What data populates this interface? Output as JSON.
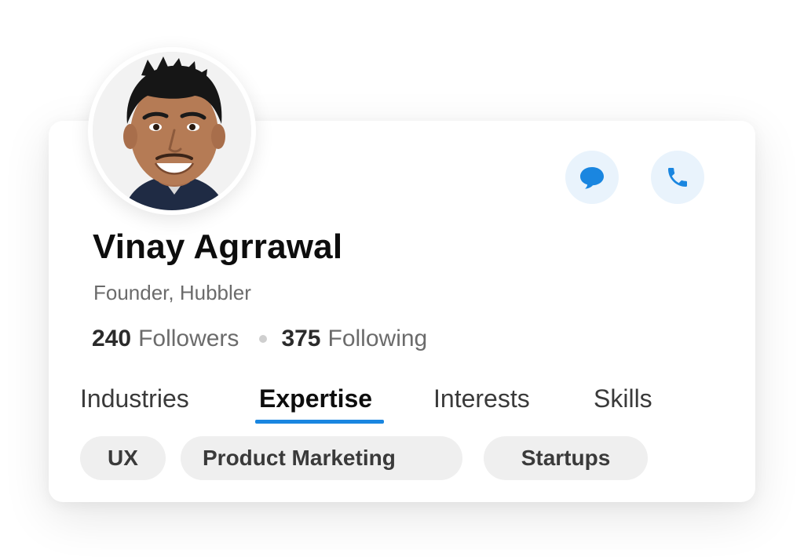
{
  "profile": {
    "name": "Vinay Agrrawal",
    "role": "Founder, Hubbler",
    "followers_count": "240",
    "followers_label": "Followers",
    "following_count": "375",
    "following_label": "Following"
  },
  "actions": {
    "message_icon": "chat-bubble-icon",
    "call_icon": "phone-icon"
  },
  "tabs": [
    {
      "label": "Industries"
    },
    {
      "label": "Expertise",
      "active": true
    },
    {
      "label": "Interests"
    },
    {
      "label": "Skills"
    }
  ],
  "chips": [
    {
      "label": "UX"
    },
    {
      "label": "Product Marketing"
    },
    {
      "label": "Startups"
    }
  ],
  "colors": {
    "accent": "#1a86e0",
    "action_bg": "#e9f3fc",
    "chip_bg": "#efefef",
    "text_primary": "#0d0d0d",
    "text_secondary": "#6b6b6b"
  }
}
